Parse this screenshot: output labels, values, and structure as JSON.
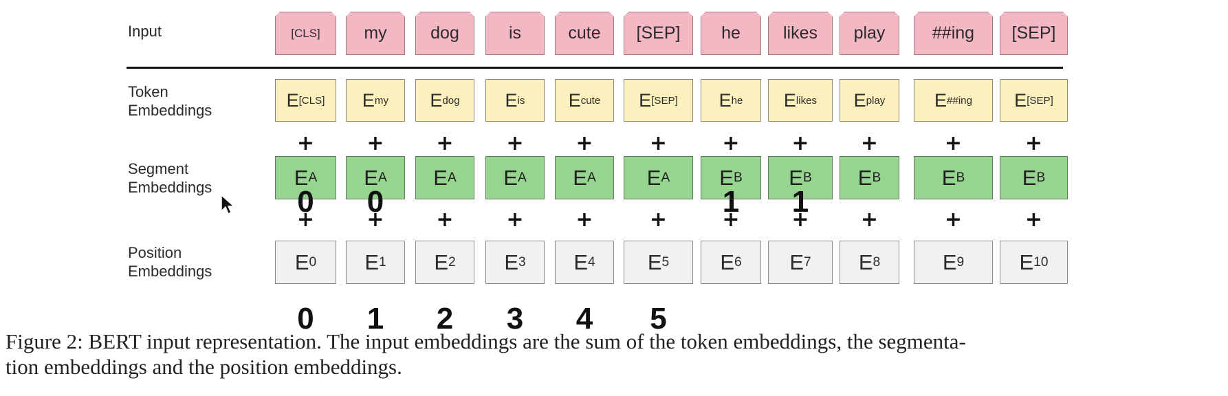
{
  "rows": {
    "input_label": "Input",
    "token_label_1": "Token",
    "token_label_2": "Embeddings",
    "segment_label_1": "Segment",
    "segment_label_2": "Embeddings",
    "position_label_1": "Position",
    "position_label_2": "Embeddings"
  },
  "tokens": [
    {
      "input": "[CLS]",
      "tok_sub": "[CLS]",
      "seg_sub": "A",
      "pos_sub": "0"
    },
    {
      "input": "my",
      "tok_sub": "my",
      "seg_sub": "A",
      "pos_sub": "1"
    },
    {
      "input": "dog",
      "tok_sub": "dog",
      "seg_sub": "A",
      "pos_sub": "2"
    },
    {
      "input": "is",
      "tok_sub": "is",
      "seg_sub": "A",
      "pos_sub": "3"
    },
    {
      "input": "cute",
      "tok_sub": "cute",
      "seg_sub": "A",
      "pos_sub": "4"
    },
    {
      "input": "[SEP]",
      "tok_sub": "[SEP]",
      "seg_sub": "A",
      "pos_sub": "5"
    },
    {
      "input": "he",
      "tok_sub": "he",
      "seg_sub": "B",
      "pos_sub": "6"
    },
    {
      "input": "likes",
      "tok_sub": "likes",
      "seg_sub": "B",
      "pos_sub": "7"
    },
    {
      "input": "play",
      "tok_sub": "play",
      "seg_sub": "B",
      "pos_sub": "8"
    },
    {
      "input": "##ing",
      "tok_sub": "##ing",
      "seg_sub": "B",
      "pos_sub": "9"
    },
    {
      "input": "[SEP]",
      "tok_sub": "[SEP]",
      "seg_sub": "B",
      "pos_sub": "10"
    }
  ],
  "embedding_prefix": "E",
  "plus_symbol": "+",
  "segment_annotations": [
    {
      "token": 0,
      "text": "0"
    },
    {
      "token": 1,
      "text": "0"
    },
    {
      "token": 6,
      "text": "1"
    },
    {
      "token": 7,
      "text": "1"
    }
  ],
  "position_annotations": [
    {
      "token": 0,
      "text": "0"
    },
    {
      "token": 1,
      "text": "1"
    },
    {
      "token": 2,
      "text": "2"
    },
    {
      "token": 3,
      "text": "3"
    },
    {
      "token": 4,
      "text": "4"
    },
    {
      "token": 5,
      "text": "5"
    }
  ],
  "caption": {
    "line1": "Figure 2: BERT input representation. The input embeddings are the sum of the token embeddings, the segmenta-",
    "line2": "tion embeddings and the position embeddings."
  }
}
